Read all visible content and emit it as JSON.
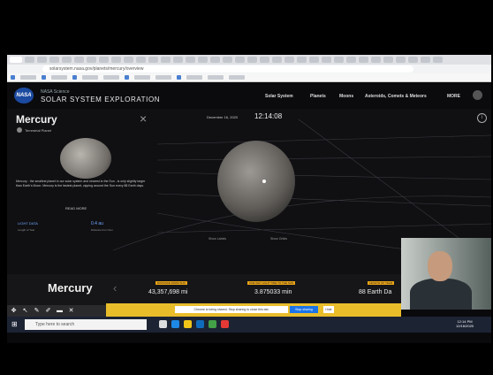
{
  "browser": {
    "url": "solarsystem.nasa.gov/planets/mercury/overview"
  },
  "site": {
    "logo": "NASA",
    "brand_small": "NASA Science",
    "brand_title": "SOLAR SYSTEM EXPLORATION",
    "nav": [
      "Solar System",
      "Planets",
      "Moons",
      "Asteroids, Comets & Meteors",
      "MORE"
    ]
  },
  "viewer": {
    "planet_title": "Mercury",
    "subtitle": "Terrestrial Planet",
    "description": "Mercury - the smallest planet in our solar system and nearest to the Sun - is only slightly larger than Earth's Moon. Mercury is the fastest planet, zipping around the Sun every 88 Earth days.",
    "read_more": "READ MORE",
    "stat1_value": "LIGHT DATA",
    "stat1_label": "Length of Year",
    "stat2_value": "0.4 au",
    "stat2_label": "Distance from Sun",
    "date": "December 16, 2020",
    "time": "12:14:08",
    "hide_toggle": "Show Labels",
    "orbit_toggle": "Show Orbits"
  },
  "databar": {
    "title": "Mercury",
    "stats": [
      {
        "tag": "DISTANCE FROM SUN",
        "value": "43,357,698 mi"
      },
      {
        "tag": "ONE WAY LIGHT TIME TO THE SUN",
        "value": "3.875033 min"
      },
      {
        "tag": "LENGTH OF YEAR",
        "value": "88 Earth Da"
      }
    ]
  },
  "banner": {
    "text": "Chrome is being shared. Stop sharing to close this tab.",
    "stop_button": "Stop sharing",
    "hide_button": "Hide"
  },
  "taskbar": {
    "search_placeholder": "Type here to search",
    "time": "12:14 PM",
    "date": "12/16/2020"
  },
  "colors": {
    "accent_blue": "#6fa8ff",
    "stat_tag": "#e8a317",
    "banner": "#e9bd2a"
  }
}
